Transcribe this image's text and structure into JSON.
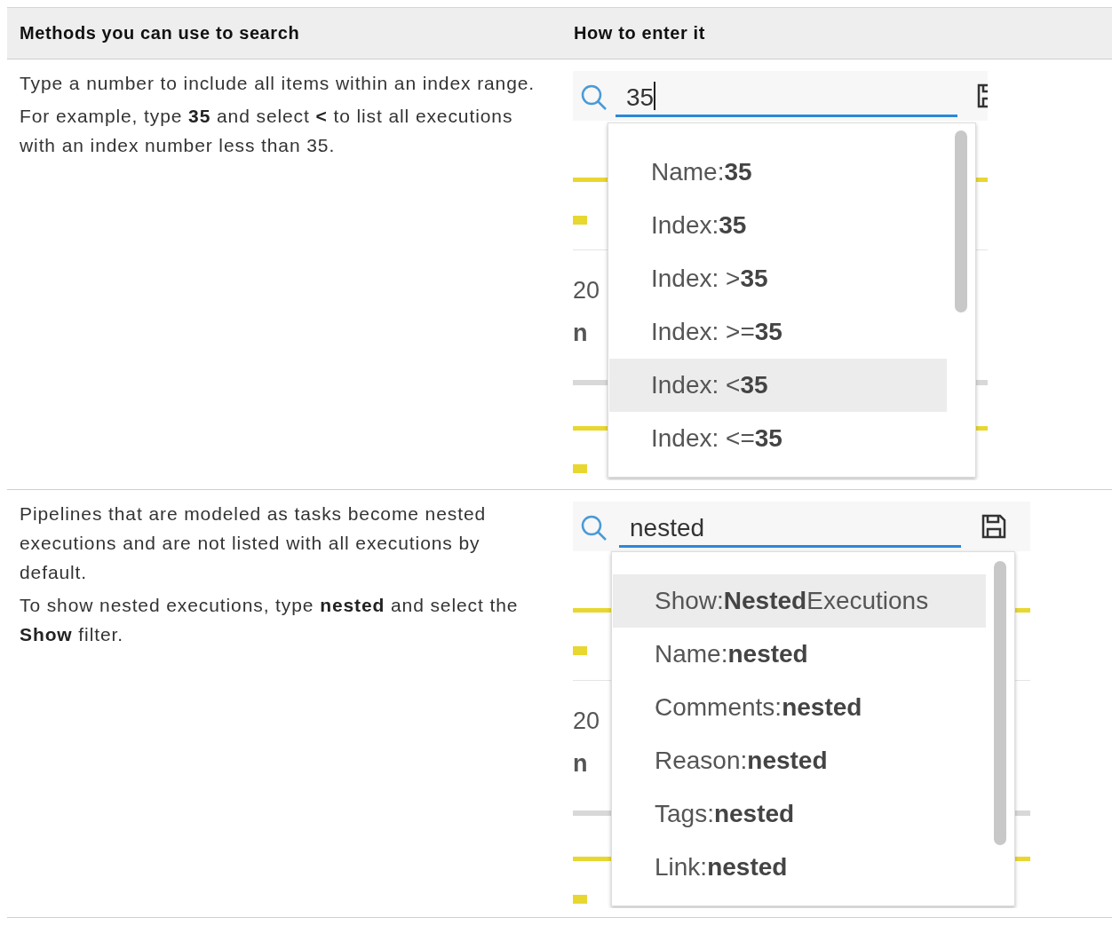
{
  "table": {
    "columns": [
      "Methods you can use to search",
      "How to enter it"
    ],
    "rows": [
      {
        "description": [
          "Type a number to include all items within an index range.",
          "For example, type **35** and select **<** to list all executions with an index number less than 35."
        ],
        "screenshot": {
          "search_value": "35",
          "cursor": true,
          "background_text": [
            "20",
            "n"
          ],
          "suggestions": [
            {
              "label": "Name:**35**",
              "selected": false
            },
            {
              "label": "Index:**35**",
              "selected": false
            },
            {
              "label": "Index: >**35**",
              "selected": false
            },
            {
              "label": "Index: >=**35**",
              "selected": false
            },
            {
              "label": "Index: <**35**",
              "selected": true
            },
            {
              "label": "Index: <=**35**",
              "selected": false
            }
          ]
        }
      },
      {
        "description": [
          "Pipelines that are modeled as tasks become nested executions and are not listed with all executions by default.",
          "To show nested executions, type **nested** and select the **Show** filter."
        ],
        "screenshot": {
          "search_value": "nested",
          "cursor": false,
          "background_text": [
            "20",
            "n"
          ],
          "suggestions": [
            {
              "label": "Show:**Nested**Executions",
              "selected": true
            },
            {
              "label": "Name:**nested**",
              "selected": false
            },
            {
              "label": "Comments:**nested**",
              "selected": false
            },
            {
              "label": "Reason:**nested**",
              "selected": false
            },
            {
              "label": "Tags:**nested**",
              "selected": false
            },
            {
              "label": "Link:**nested**",
              "selected": false
            }
          ]
        }
      }
    ]
  }
}
